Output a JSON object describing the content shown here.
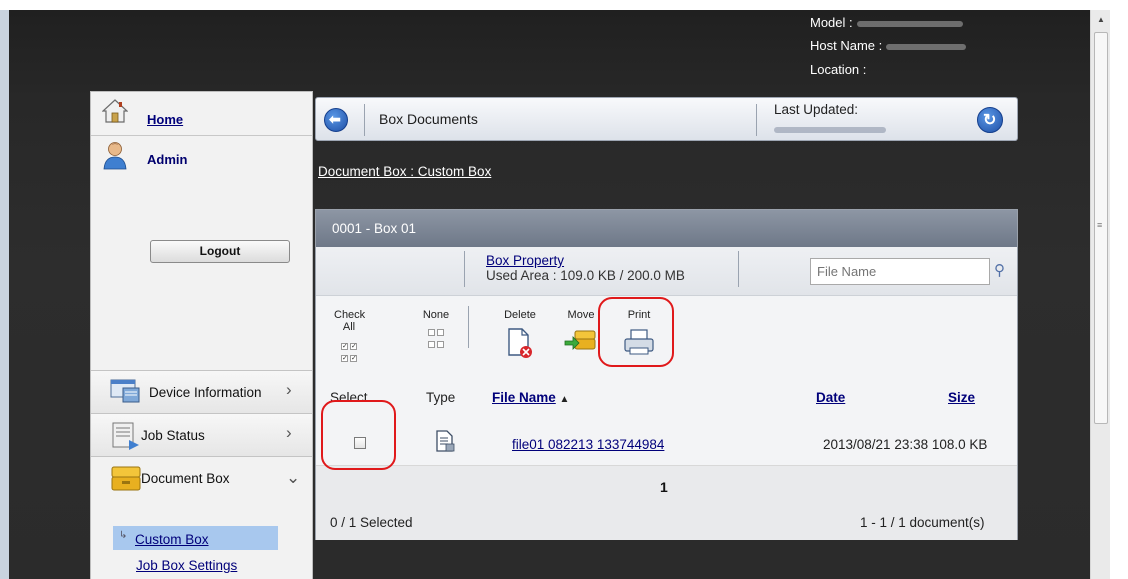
{
  "header": {
    "model_label": "Model :",
    "host_label": "Host Name :",
    "location_label": "Location :"
  },
  "sidebar": {
    "home_label": "Home",
    "user_label": "Admin",
    "logout_label": "Logout",
    "nav": [
      {
        "label": "Device Information",
        "icon": "device-info-icon",
        "chevron": "›"
      },
      {
        "label": "Job Status",
        "icon": "job-status-icon",
        "chevron": "›"
      },
      {
        "label": "Document Box",
        "icon": "document-box-icon",
        "chevron": "⌄"
      }
    ],
    "sub_items": [
      {
        "label": "Custom Box",
        "selected": true
      },
      {
        "label": "Job Box Settings",
        "selected": false
      }
    ]
  },
  "topbar": {
    "title": "Box Documents",
    "last_updated_label": "Last Updated:"
  },
  "breadcrumb": "Document Box : Custom Box",
  "box": {
    "title": "0001 - Box 01",
    "property_link": "Box Property",
    "used_area": "Used Area : 109.0 KB / 200.0 MB",
    "search_placeholder": "File Name",
    "tools": {
      "check_all": "Check All",
      "none": "None",
      "delete": "Delete",
      "move": "Move",
      "print": "Print"
    },
    "columns": {
      "select": "Select",
      "type": "Type",
      "file_name": "File Name",
      "sort_indicator": "▲",
      "date": "Date",
      "size": "Size"
    },
    "rows": [
      {
        "file_name": "file01 082213 133744984",
        "date_size": "2013/08/21 23:38 108.0 KB",
        "checked": false
      }
    ],
    "page": "1",
    "selected_count": "0 / 1 Selected",
    "doc_count": "1 - 1 / 1 document(s)"
  },
  "colors": {
    "highlight_ring": "#e0191b",
    "link": "#00007a",
    "selected_nav": "#a8c8ee"
  }
}
